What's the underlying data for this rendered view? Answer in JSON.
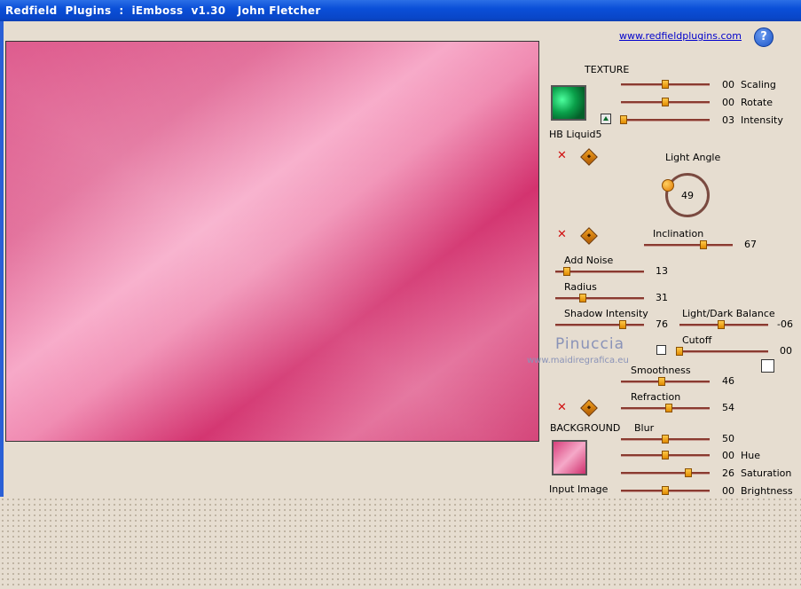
{
  "window": {
    "title": "Redfield  Plugins  :  iEmboss  v1.30   John Fletcher"
  },
  "header": {
    "link": "www.redfieldplugins.com",
    "help": "?"
  },
  "texture": {
    "section_label": "TEXTURE",
    "name": "HB Liquid5",
    "sliders": [
      {
        "label": "Scaling",
        "value": "00",
        "position": 0.5
      },
      {
        "label": "Rotate",
        "value": "00",
        "position": 0.5
      },
      {
        "label": "Intensity",
        "value": "03",
        "position": 0.03
      }
    ]
  },
  "light_angle": {
    "label": "Light  Angle",
    "value": "49"
  },
  "inclination": {
    "label": "Inclination",
    "value": "67",
    "position": 0.67
  },
  "add_noise": {
    "label": "Add Noise",
    "value": "13",
    "position": 0.13
  },
  "radius": {
    "label": "Radius",
    "value": "31",
    "position": 0.31
  },
  "shadow_intensity": {
    "label": "Shadow Intensity",
    "value": "76",
    "position": 0.76
  },
  "light_dark_balance": {
    "label": "Light/Dark Balance",
    "value": "-06",
    "position": 0.47
  },
  "cutoff": {
    "label": "Cutoff",
    "value": "00",
    "position": 0.0
  },
  "smoothness": {
    "label": "Smoothness",
    "value": "46",
    "position": 0.46
  },
  "refraction": {
    "label": "Refraction",
    "value": "54",
    "position": 0.54
  },
  "background": {
    "section_label": "BACKGROUND",
    "name": "Input Image",
    "sliders": [
      {
        "label": "Blur",
        "value": "50",
        "position": 0.5
      },
      {
        "label": "Hue",
        "value": "00",
        "position": 0.5
      },
      {
        "label": "Saturation",
        "value": "26",
        "position": 0.76
      },
      {
        "label": "Brightness",
        "value": "00",
        "position": 0.5
      }
    ]
  },
  "watermark": {
    "name": "Pinuccia",
    "site": "www.maidiregrafica.eu"
  },
  "colors": {
    "title_bar": "#0a4fd8",
    "preview_pink": "#cc2a68",
    "panel_bg": "#e6ddd0",
    "knob": "#e08a00"
  },
  "icons": [
    "help-icon",
    "texture-thumbnail",
    "invert-icon",
    "reset-x-icon",
    "randomize-diamond-icon",
    "light-angle-dial"
  ]
}
